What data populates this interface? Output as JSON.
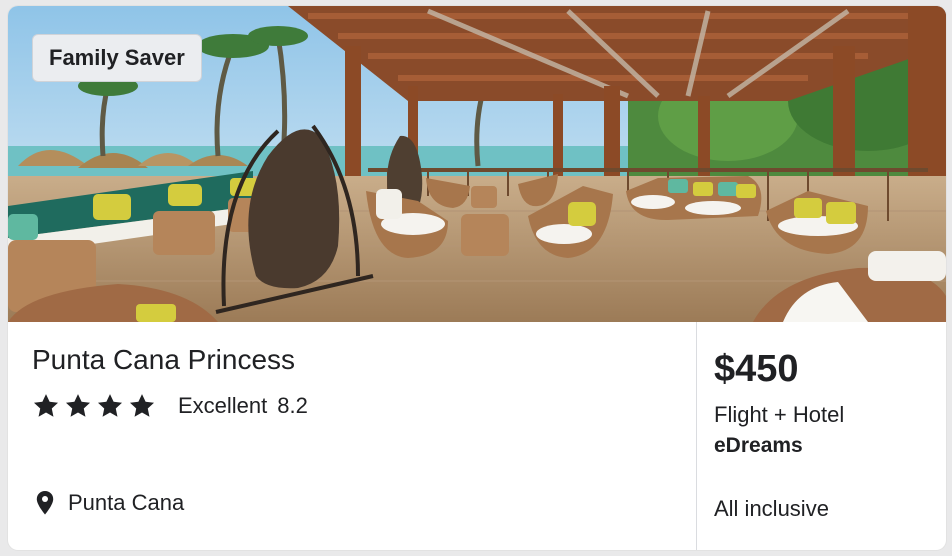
{
  "hotel_card": {
    "badge": "Family Saver",
    "hotel_name": "Punta Cana Princess",
    "star_rating": 4,
    "rating_label": "Excellent",
    "rating_score": "8.2",
    "location": "Punta Cana",
    "price": "$450",
    "package_type": "Flight + Hotel",
    "provider": "eDreams",
    "board_type": "All inclusive"
  },
  "icons": {
    "star": "star-icon",
    "location": "map-pin-icon"
  },
  "colors": {
    "text": "#202124",
    "badge_bg": "#ebedf0",
    "divider": "#dadce0"
  }
}
